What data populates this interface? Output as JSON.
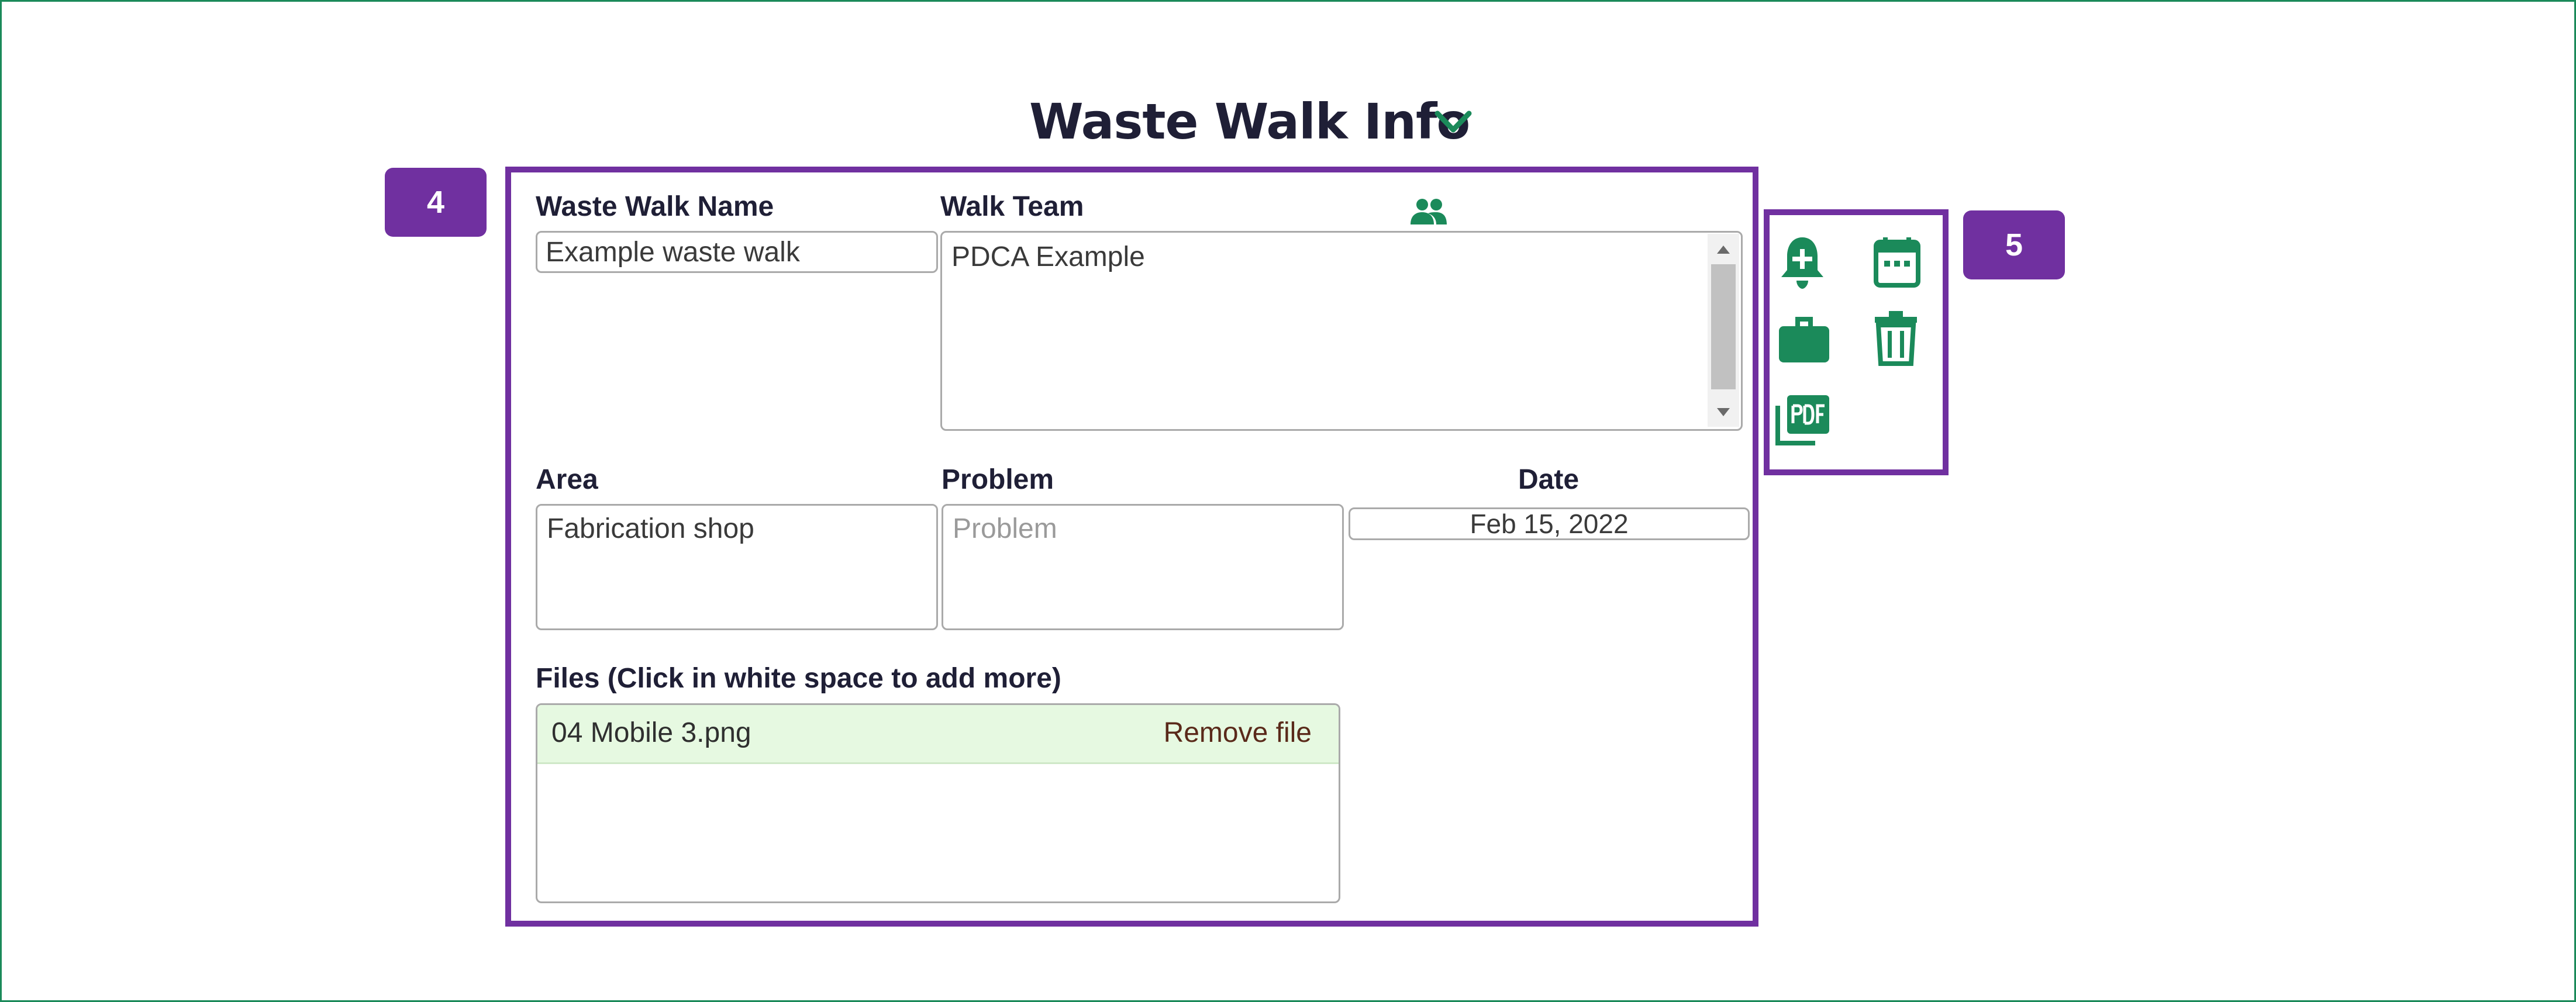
{
  "header": {
    "title": "Waste Walk Info",
    "chevron_icon": "chevron-down-icon"
  },
  "callouts": {
    "form_number": "4",
    "actions_number": "5"
  },
  "form": {
    "waste_walk_name": {
      "label": "Waste Walk Name",
      "value": "Example waste walk"
    },
    "walk_team": {
      "label": "Walk Team",
      "value": "PDCA Example",
      "icon": "people-icon"
    },
    "area": {
      "label": "Area",
      "value": "Fabrication shop"
    },
    "problem": {
      "label": "Problem",
      "value": "",
      "placeholder": "Problem"
    },
    "date": {
      "label": "Date",
      "value": "Feb 15, 2022"
    },
    "files": {
      "label": "Files (Click in white space to add more)",
      "items": [
        {
          "name": "04 Mobile 3.png",
          "remove_label": "Remove file"
        }
      ]
    }
  },
  "actions": {
    "icons": [
      "add-alert-icon",
      "calendar-icon",
      "briefcase-icon",
      "trash-icon",
      "pdf-icon"
    ]
  },
  "colors": {
    "accent_green": "#1b8a5a",
    "callout_purple": "#7030a0",
    "file_row_bg": "#e6f9e1"
  }
}
